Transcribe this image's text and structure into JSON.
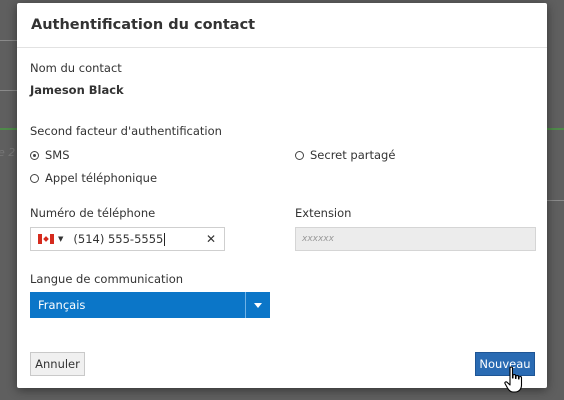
{
  "dialog": {
    "title": "Authentification du contact",
    "contact_name_label": "Nom du contact",
    "contact_name_value": "Jameson Black",
    "second_factor_label": "Second facteur d'authentification",
    "options": {
      "sms": "SMS",
      "shared_secret": "Secret partagé",
      "phone_call": "Appel téléphonique"
    },
    "selected_option": "sms",
    "phone_label": "Numéro de téléphone",
    "phone_value": "(514) 555-5555",
    "phone_country_icon": "canada-flag-icon",
    "extension_label": "Extension",
    "extension_placeholder": "xxxxxx",
    "language_label": "Langue de communication",
    "language_value": "Français",
    "cancel_label": "Annuler",
    "new_label": "Nouveau"
  },
  "background": {
    "partial_text": "e 2"
  },
  "colors": {
    "primary": "#0b76c8",
    "button_primary": "#2a6bb3",
    "overlay": "#5f5f5f"
  }
}
